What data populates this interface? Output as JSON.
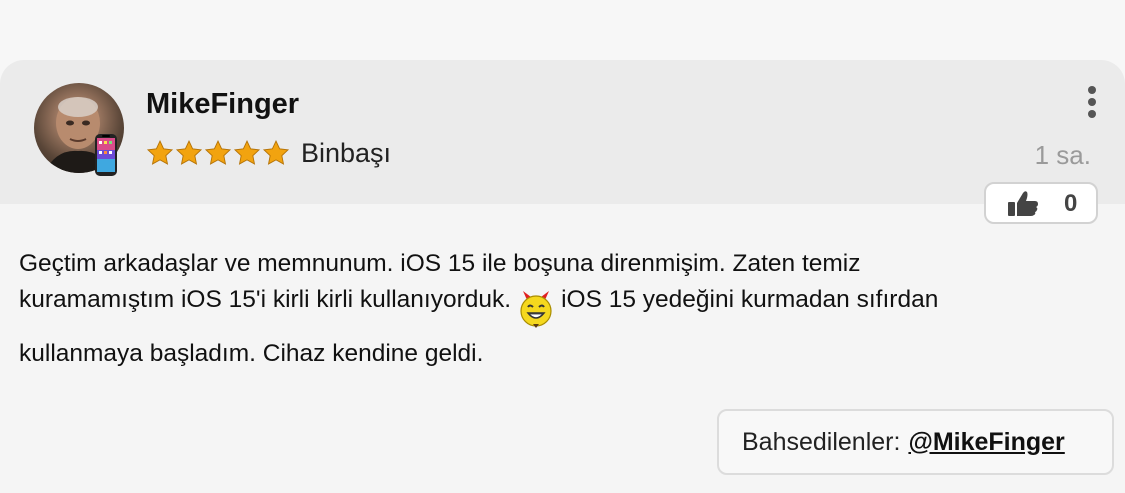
{
  "post": {
    "author": {
      "username": "MikeFinger",
      "rank": "Binbaşı",
      "stars": 5,
      "avatar_icon": "user-avatar-photo",
      "device_icon": "iphone-icon"
    },
    "timestamp": "1 sa.",
    "menu_icon": "vertical-ellipsis-icon",
    "like": {
      "icon": "thumbs-up-icon",
      "count": "0"
    },
    "body": {
      "line1": "Geçtim arkadaşlar ve memnunum. iOS 15 ile boşuna direnmişim. Zaten temiz",
      "line2_before": "kuramamıştım iOS 15'i kirli kirli kullanıyorduk.",
      "emoji_icon": "devil-grin-emoji-icon",
      "line2_after": "iOS 15 yedeğini kurmadan sıfırdan",
      "line3": "kullanmaya başladım. Cihaz kendine geldi."
    },
    "mentions": {
      "label": "Bahsedilenler:",
      "user": "@MikeFinger"
    }
  },
  "colors": {
    "header_bg": "#ebebeb",
    "card_bg": "#f5f5f5",
    "star": "#f2a30f",
    "timestamp": "#9a9a9a"
  }
}
